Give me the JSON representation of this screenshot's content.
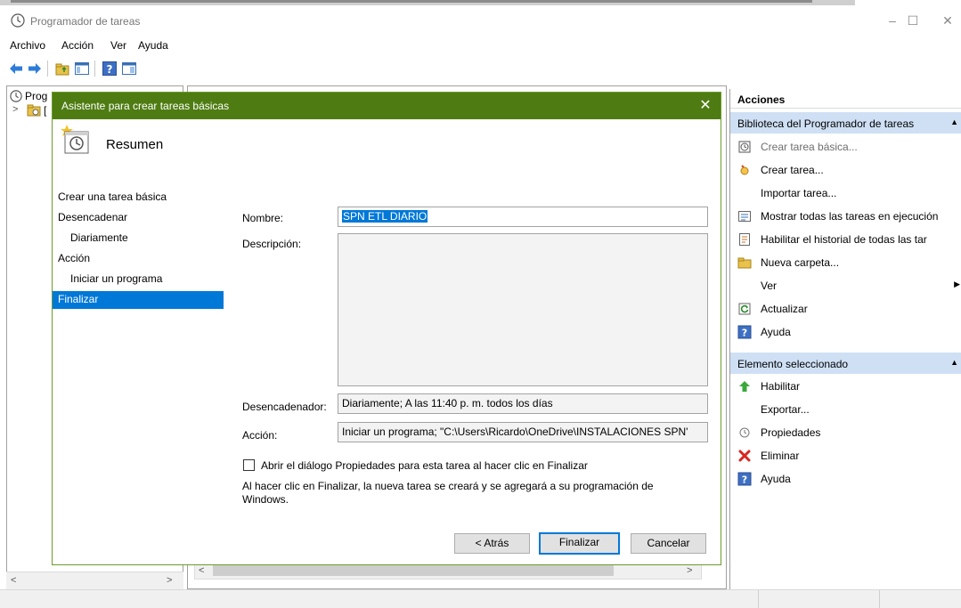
{
  "window": {
    "title": "Programador de tareas",
    "controls": [
      "–",
      "☐",
      "✕"
    ]
  },
  "menu": [
    "Archivo",
    "Acción",
    "Ver",
    "Ayuda"
  ],
  "tree": {
    "root_label": "Prog",
    "child_label": "["
  },
  "wizard": {
    "title": "Asistente para crear tareas básicas",
    "close": "✕",
    "header_title": "Resumen",
    "nav": [
      {
        "label": "Crear una tarea básica"
      },
      {
        "label": "Desencadenar"
      },
      {
        "label": "Diariamente"
      },
      {
        "label": "Acción"
      },
      {
        "label": "Iniciar un programa"
      },
      {
        "label": "Finalizar"
      }
    ],
    "fields": {
      "nombre_label": "Nombre:",
      "nombre_value": "SPN ETL DIARIO",
      "descripcion_label": "Descripción:",
      "descripcion_value": "",
      "desencadenador_label": "Desencadenador:",
      "desencadenador_value": "Diariamente; A las 11:40 p. m. todos los días",
      "accion_label": "Acción:",
      "accion_value": "Iniciar un programa; \"C:\\Users\\Ricardo\\OneDrive\\INSTALACIONES SPN'"
    },
    "checkbox_label": "Abrir el diálogo Propiedades para esta tarea al hacer clic en Finalizar",
    "info_text_line1": "Al hacer clic en Finalizar, la nueva tarea se creará y se agregará a su programación de",
    "info_text_line2": "Windows.",
    "buttons": {
      "back": "< Atrás",
      "finish": "Finalizar",
      "cancel": "Cancelar"
    }
  },
  "actions": {
    "header": "Acciones",
    "section1": "Biblioteca del Programador de tareas",
    "section1_items": [
      {
        "label": "Crear tarea básica...",
        "icon": "create-basic-task-icon"
      },
      {
        "label": "Crear tarea...",
        "icon": "create-task-icon"
      },
      {
        "label": "Importar tarea...",
        "icon": ""
      },
      {
        "label": "Mostrar todas las tareas en ejecución",
        "icon": "running-tasks-icon"
      },
      {
        "label": "Habilitar el historial de todas las tar",
        "icon": "history-icon"
      },
      {
        "label": "Nueva carpeta...",
        "icon": "folder-icon"
      },
      {
        "label": "Ver",
        "icon": ""
      },
      {
        "label": "Actualizar",
        "icon": "refresh-icon"
      },
      {
        "label": "Ayuda",
        "icon": "help-icon"
      }
    ],
    "section2": "Elemento seleccionado",
    "section2_items": [
      {
        "label": "Habilitar",
        "icon": "enable-icon"
      },
      {
        "label": "Exportar...",
        "icon": ""
      },
      {
        "label": "Propiedades",
        "icon": "properties-icon"
      },
      {
        "label": "Eliminar",
        "icon": "delete-icon"
      },
      {
        "label": "Ayuda",
        "icon": "help-icon"
      }
    ]
  },
  "colors": {
    "wizard_title_bg": "#4e7c12",
    "selection_blue": "#0078d7",
    "section_bg": "#cfe0f5"
  }
}
